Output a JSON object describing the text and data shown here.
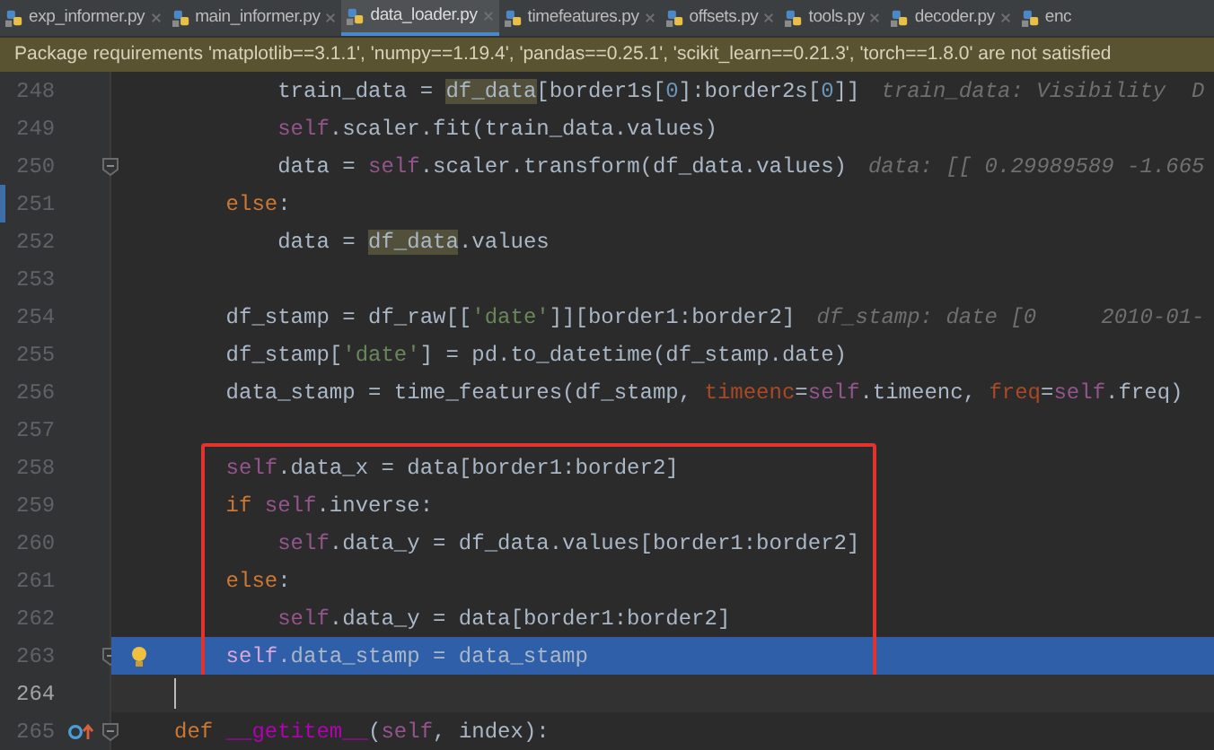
{
  "tabs": [
    {
      "label": "exp_informer.py",
      "selected": false
    },
    {
      "label": "main_informer.py",
      "selected": false
    },
    {
      "label": "data_loader.py",
      "selected": true
    },
    {
      "label": "timefeatures.py",
      "selected": false
    },
    {
      "label": "offsets.py",
      "selected": false
    },
    {
      "label": "tools.py",
      "selected": false
    },
    {
      "label": "decoder.py",
      "selected": false
    },
    {
      "label": "enc",
      "selected": false
    }
  ],
  "banner": {
    "text": "Package requirements 'matplotlib==3.1.1', 'numpy==1.19.4', 'pandas==0.25.1', 'scikit_learn==0.21.3', 'torch==1.8.0' are not satisfied"
  },
  "editor": {
    "sections": [
      {
        "kind": "plain",
        "lines": [
          {
            "number": "248",
            "selected": false,
            "caret": false,
            "tokens": [
              {
                "kind": "plain",
                "text": "        train_data = "
              },
              {
                "kind": "usage",
                "text": "df_data"
              },
              {
                "kind": "plain",
                "text": "[border1s["
              },
              {
                "kind": "number",
                "text": "0"
              },
              {
                "kind": "plain",
                "text": "]:border2s["
              },
              {
                "kind": "number",
                "text": "0"
              },
              {
                "kind": "plain",
                "text": "]]"
              }
            ],
            "hint": "train_data: Visibility  D"
          },
          {
            "number": "249",
            "selected": false,
            "caret": false,
            "tokens": [
              {
                "kind": "self",
                "text": "        self"
              },
              {
                "kind": "plain",
                "text": ".scaler.fit(train_data.values)"
              }
            ]
          },
          {
            "number": "250",
            "selected": false,
            "caret": false,
            "gutter": [
              {
                "kind": "fold"
              }
            ],
            "tokens": [
              {
                "kind": "plain",
                "text": "        data = "
              },
              {
                "kind": "self",
                "text": "self"
              },
              {
                "kind": "plain",
                "text": ".scaler.transform(df_data.values)"
              }
            ],
            "hint": "data: [[ 0.29989589 -1.665"
          },
          {
            "number": "251",
            "selected": false,
            "caret": false,
            "gutter": [
              {
                "kind": "change"
              }
            ],
            "tokens": [
              {
                "kind": "keyword",
                "text": "    else"
              },
              {
                "kind": "plain",
                "text": ":"
              }
            ]
          },
          {
            "number": "252",
            "selected": false,
            "caret": false,
            "tokens": [
              {
                "kind": "plain",
                "text": "        data = "
              },
              {
                "kind": "usage",
                "text": "df_data"
              },
              {
                "kind": "plain",
                "text": ".values"
              }
            ]
          },
          {
            "number": "253",
            "selected": false,
            "caret": false
          },
          {
            "number": "254",
            "selected": false,
            "caret": false,
            "tokens": [
              {
                "kind": "plain",
                "text": "    df_stamp = df_raw[["
              },
              {
                "kind": "string",
                "text": "'date'"
              },
              {
                "kind": "plain",
                "text": "]][border1:border2]"
              }
            ],
            "hint": "df_stamp: date [0     2010-01-"
          },
          {
            "number": "255",
            "selected": false,
            "caret": false,
            "tokens": [
              {
                "kind": "plain",
                "text": "    df_stamp["
              },
              {
                "kind": "string",
                "text": "'date'"
              },
              {
                "kind": "plain",
                "text": "] = pd.to_datetime(df_stamp.date)"
              }
            ]
          },
          {
            "number": "256",
            "selected": false,
            "caret": false,
            "tokens": [
              {
                "kind": "plain",
                "text": "    data_stamp = time_features(df_stamp, "
              },
              {
                "kind": "param",
                "text": "timeenc"
              },
              {
                "kind": "plain",
                "text": "="
              },
              {
                "kind": "self",
                "text": "self"
              },
              {
                "kind": "plain",
                "text": ".timeenc, "
              },
              {
                "kind": "param",
                "text": "freq"
              },
              {
                "kind": "plain",
                "text": "="
              },
              {
                "kind": "self",
                "text": "self"
              },
              {
                "kind": "plain",
                "text": ".freq)"
              }
            ]
          },
          {
            "number": "257",
            "selected": false,
            "caret": false
          }
        ]
      },
      {
        "kind": "boxed",
        "lines": [
          {
            "number": "258",
            "selected": false,
            "caret": false,
            "tokens": [
              {
                "kind": "self",
                "text": "    self"
              },
              {
                "kind": "plain",
                "text": ".data_x = data[border1:border2]"
              }
            ]
          },
          {
            "number": "259",
            "selected": false,
            "caret": false,
            "tokens": [
              {
                "kind": "keyword",
                "text": "    if "
              },
              {
                "kind": "self",
                "text": "self"
              },
              {
                "kind": "plain",
                "text": ".inverse:"
              }
            ]
          },
          {
            "number": "260",
            "selected": false,
            "caret": false,
            "tokens": [
              {
                "kind": "self",
                "text": "        self"
              },
              {
                "kind": "plain",
                "text": ".data_y = df_data.values[border1:border2]"
              }
            ]
          },
          {
            "number": "261",
            "selected": false,
            "caret": false,
            "tokens": [
              {
                "kind": "keyword",
                "text": "    else"
              },
              {
                "kind": "plain",
                "text": ":"
              }
            ]
          },
          {
            "number": "262",
            "selected": false,
            "caret": false,
            "tokens": [
              {
                "kind": "self",
                "text": "        self"
              },
              {
                "kind": "plain",
                "text": ".data_y = data[border1:border2]"
              }
            ]
          },
          {
            "number": "263",
            "selected": true,
            "caret": false,
            "gutter": [
              {
                "kind": "fold"
              },
              {
                "kind": "bulb"
              }
            ],
            "tokens": [
              {
                "kind": "self",
                "text": "    self"
              },
              {
                "kind": "plain",
                "text": ".data_stamp = data_stamp"
              }
            ]
          }
        ]
      },
      {
        "kind": "plain",
        "lines": [
          {
            "number": "264",
            "selected": false,
            "caret": true
          },
          {
            "number": "265",
            "selected": false,
            "caret": false,
            "gutter": [
              {
                "kind": "override"
              },
              {
                "kind": "fold"
              }
            ],
            "tokens": [
              {
                "kind": "keyword",
                "text": "def "
              },
              {
                "kind": "dunder",
                "text": "__getitem__"
              },
              {
                "kind": "plain",
                "text": "("
              },
              {
                "kind": "self",
                "text": "self"
              },
              {
                "kind": "plain",
                "text": ", index):"
              }
            ]
          }
        ]
      }
    ]
  }
}
